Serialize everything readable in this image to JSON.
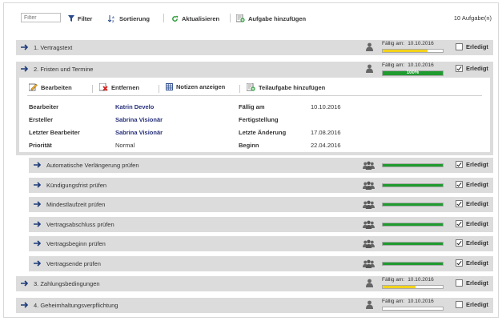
{
  "toolbar": {
    "filter_placeholder": "Filter",
    "filter_label": "Filter",
    "sort_label": "Sortierung",
    "refresh_label": "Aktualisieren",
    "add_label": "Aufgabe hinzufügen",
    "count": "10 Aufgabe(n)"
  },
  "due_label": "Fällig am:",
  "done_label": "Erledigt",
  "colors": {
    "progress_yellow": "#f2d21b",
    "progress_green": "#1f9b2f",
    "row_bg": "#dcdcdc",
    "link": "#27307a"
  },
  "tasks": [
    {
      "title": "1. Vertragstext",
      "due": "10.10.2016",
      "progress": 0.75,
      "done": false
    },
    {
      "title": "2. Fristen und Termine",
      "due": "10.10.2016",
      "progress": 1.0,
      "progress_text": "100%",
      "done": true
    },
    {
      "title": "3. Zahlungsbedingungen",
      "due": "10.10.2016",
      "progress": 0.55,
      "done": false
    },
    {
      "title": "4. Geheimhaltungsverpflichtung",
      "due": "10.10.2016",
      "progress": 0.0,
      "done": false
    }
  ],
  "detail": {
    "actions": {
      "edit": "Bearbeiten",
      "remove": "Entfernen",
      "notes": "Notizen anzeigen",
      "add_sub": "Teilaufgabe hinzufügen"
    },
    "fields": {
      "bearbeiter_label": "Bearbeiter",
      "bearbeiter": "Katrin Develo",
      "ersteller_label": "Ersteller",
      "ersteller": "Sabrina Visionär",
      "letzter_label": "Letzter Bearbeiter",
      "letzter": "Sabrina Visionär",
      "prio_label": "Priorität",
      "prio": "Normal",
      "faellig_label": "Fällig am",
      "faellig": "10.10.2016",
      "fertig_label": "Fertigstellung",
      "fertig": "",
      "aenderung_label": "Letzte Änderung",
      "aenderung": "17.08.2016",
      "beginn_label": "Beginn",
      "beginn": "22.04.2016"
    }
  },
  "subtasks": [
    {
      "title": "Automatische Verlängerung prüfen",
      "progress": 1.0,
      "done": true
    },
    {
      "title": "Kündigungsfrist prüfen",
      "progress": 1.0,
      "done": true
    },
    {
      "title": "Mindestlaufzeit prüfen",
      "progress": 1.0,
      "done": true
    },
    {
      "title": "Vertragsabschluss prüfen",
      "progress": 1.0,
      "done": true
    },
    {
      "title": "Vertragsbeginn prüfen",
      "progress": 1.0,
      "done": true
    },
    {
      "title": "Vertragsende prüfen",
      "progress": 1.0,
      "done": true
    }
  ]
}
